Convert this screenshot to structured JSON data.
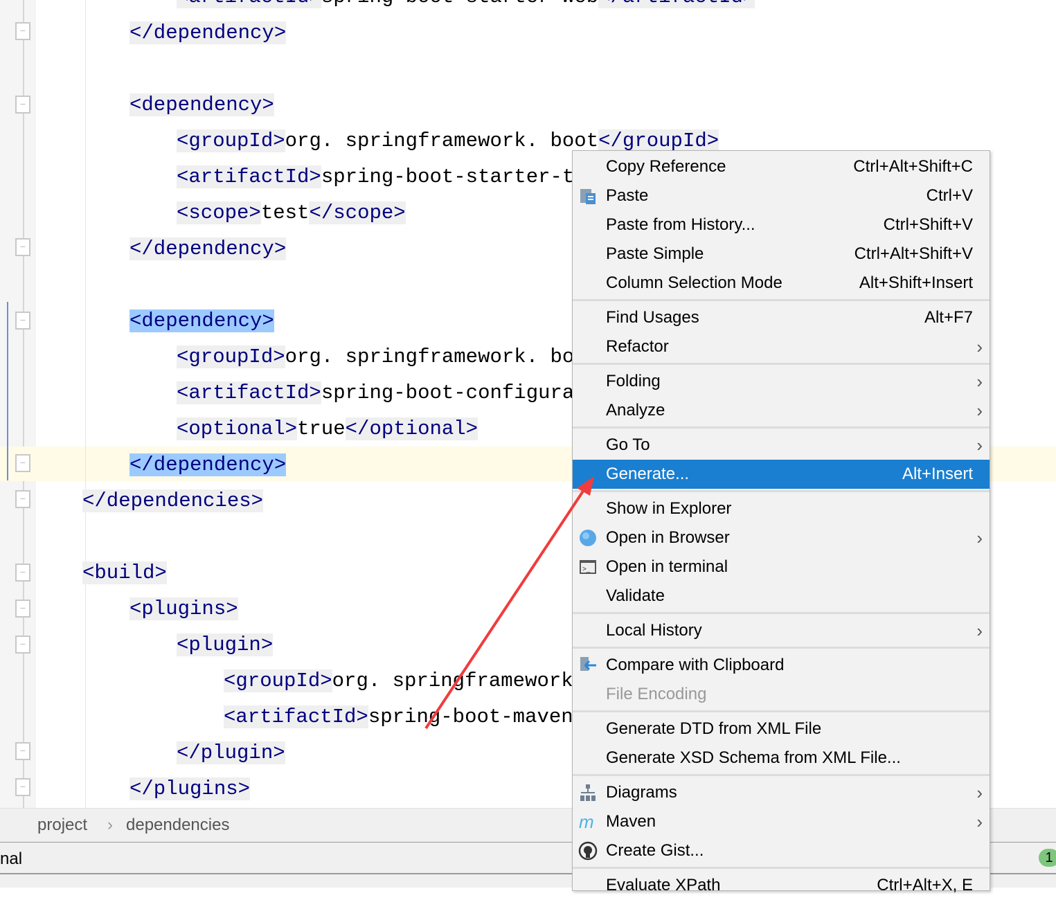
{
  "editor": {
    "lines": [
      {
        "indent": 3,
        "parts": [
          [
            "t",
            "<artifactId>"
          ],
          [
            "v",
            "spring-boot-starter-web"
          ],
          [
            "t",
            "</artifactId>"
          ]
        ]
      },
      {
        "indent": 2,
        "parts": [
          [
            "t",
            "</dependency>"
          ]
        ]
      },
      {
        "indent": 2,
        "parts": [
          [
            "t",
            "<dependency>"
          ]
        ]
      },
      {
        "indent": 3,
        "parts": [
          [
            "t",
            "<groupId>"
          ],
          [
            "v",
            "org. springframework. boot"
          ],
          [
            "t",
            "</groupId>"
          ]
        ]
      },
      {
        "indent": 3,
        "parts": [
          [
            "t",
            "<artifactId>"
          ],
          [
            "v",
            "spring-boot-starter-test"
          ]
        ]
      },
      {
        "indent": 3,
        "parts": [
          [
            "t",
            "<scope>"
          ],
          [
            "v",
            "test"
          ],
          [
            "t",
            "</scope>"
          ]
        ]
      },
      {
        "indent": 2,
        "parts": [
          [
            "t",
            "</dependency>"
          ]
        ]
      },
      {
        "indent": 2,
        "parts": [
          [
            "s",
            "<dependency>"
          ]
        ]
      },
      {
        "indent": 3,
        "parts": [
          [
            "t",
            "<groupId>"
          ],
          [
            "v",
            "org. springframework. boot"
          ]
        ]
      },
      {
        "indent": 3,
        "parts": [
          [
            "t",
            "<artifactId>"
          ],
          [
            "v",
            "spring-boot-configura"
          ]
        ]
      },
      {
        "indent": 3,
        "parts": [
          [
            "t",
            "<optional>"
          ],
          [
            "v",
            "true"
          ],
          [
            "t",
            "</optional>"
          ]
        ]
      },
      {
        "indent": 2,
        "parts": [
          [
            "s",
            "</dependency>"
          ]
        ]
      },
      {
        "indent": 1,
        "parts": [
          [
            "t",
            "</dependencies>"
          ]
        ]
      },
      {
        "indent": 1,
        "parts": [
          [
            "t",
            "<build>"
          ]
        ]
      },
      {
        "indent": 2,
        "parts": [
          [
            "t",
            "<plugins>"
          ]
        ]
      },
      {
        "indent": 3,
        "parts": [
          [
            "t",
            "<plugin>"
          ]
        ]
      },
      {
        "indent": 4,
        "parts": [
          [
            "t",
            "<groupId>"
          ],
          [
            "v",
            "org. springframework. "
          ]
        ]
      },
      {
        "indent": 4,
        "parts": [
          [
            "t",
            "<artifactId>"
          ],
          [
            "v",
            "spring-boot-maven"
          ]
        ]
      },
      {
        "indent": 3,
        "parts": [
          [
            "t",
            "</plugin>"
          ]
        ]
      },
      {
        "indent": 2,
        "parts": [
          [
            "t",
            "</plugins>"
          ]
        ]
      }
    ]
  },
  "breadcrumb": {
    "items": [
      "project",
      "dependencies"
    ]
  },
  "status": {
    "text": "nal",
    "badge": "1"
  },
  "menu": {
    "items": [
      {
        "label": "Copy Reference",
        "shortcut": "Ctrl+Alt+Shift+C"
      },
      {
        "label": "Paste",
        "shortcut": "Ctrl+V",
        "icon": "clipboard-icon"
      },
      {
        "label": "Paste from History...",
        "shortcut": "Ctrl+Shift+V"
      },
      {
        "label": "Paste Simple",
        "shortcut": "Ctrl+Alt+Shift+V"
      },
      {
        "label": "Column Selection Mode",
        "shortcut": "Alt+Shift+Insert"
      },
      {
        "sep": true
      },
      {
        "label": "Find Usages",
        "shortcut": "Alt+F7"
      },
      {
        "label": "Refactor",
        "submenu": true
      },
      {
        "sep": true
      },
      {
        "label": "Folding",
        "submenu": true
      },
      {
        "label": "Analyze",
        "submenu": true
      },
      {
        "sep": true
      },
      {
        "label": "Go To",
        "submenu": true
      },
      {
        "label": "Generate...",
        "shortcut": "Alt+Insert",
        "highlighted": true
      },
      {
        "sep": true
      },
      {
        "label": "Show in Explorer"
      },
      {
        "label": "Open in Browser",
        "submenu": true,
        "icon": "globe-icon"
      },
      {
        "label": "Open in terminal",
        "icon": "terminal-icon"
      },
      {
        "label": "Validate"
      },
      {
        "sep": true
      },
      {
        "label": "Local History",
        "submenu": true
      },
      {
        "sep": true
      },
      {
        "label": "Compare with Clipboard",
        "icon": "compare-icon"
      },
      {
        "label": "File Encoding",
        "disabled": true
      },
      {
        "sep": true
      },
      {
        "label": "Generate DTD from XML File"
      },
      {
        "label": "Generate XSD Schema from XML File..."
      },
      {
        "sep": true
      },
      {
        "label": "Diagrams",
        "submenu": true,
        "icon": "diagram-icon"
      },
      {
        "label": "Maven",
        "submenu": true,
        "icon": "maven-icon"
      },
      {
        "label": "Create Gist...",
        "icon": "github-icon"
      },
      {
        "sep": true
      },
      {
        "label": "Evaluate XPath",
        "shortcut": "Ctrl+Alt+X, E"
      }
    ]
  },
  "colors": {
    "highlight": "#1a7fd0",
    "tag": "#000080",
    "annotation_arrow": "#f03c3c"
  }
}
